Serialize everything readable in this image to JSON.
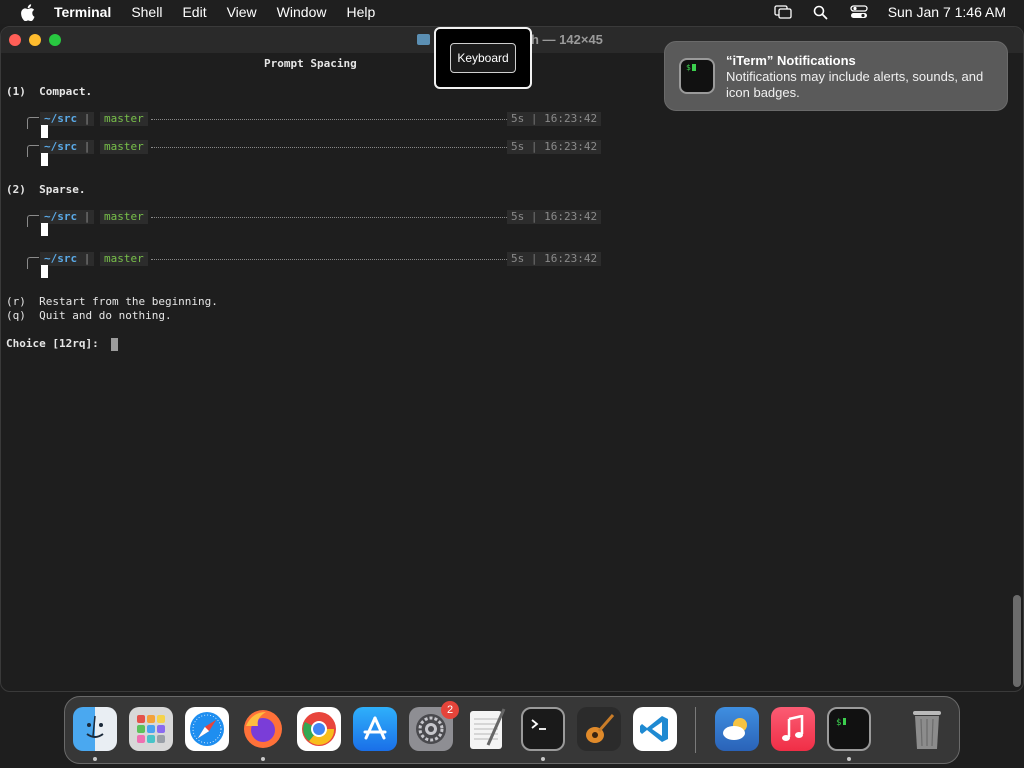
{
  "menubar": {
    "app_name": "Terminal",
    "items": [
      "Shell",
      "Edit",
      "View",
      "Window",
      "Help"
    ],
    "clock": "Sun Jan 7  1:46 AM"
  },
  "window": {
    "title_suffix": "h — 142×45"
  },
  "terminal": {
    "heading": "Prompt Spacing",
    "option1": "(1)  Compact.",
    "option2": "(2)  Sparse.",
    "prompt": {
      "dir": "~/src",
      "sep": "|",
      "branch": "master",
      "duration": "5s",
      "time": "16:23:42"
    },
    "restart": "(r)  Restart from the beginning.",
    "quit": "(q)  Quit and do nothing.",
    "choice": "Choice [12rq]: "
  },
  "keyboard_tooltip": {
    "label": "Keyboard"
  },
  "notification": {
    "title": "“iTerm” Notifications",
    "body": "Notifications may include alerts, sounds, and icon badges.",
    "icon_text": "$"
  },
  "dock": {
    "settings_badge": "2",
    "apps": [
      "finder",
      "launchpad",
      "safari",
      "firefox",
      "chrome",
      "app-store",
      "system-settings",
      "textedit",
      "terminal",
      "garageband",
      "vscode",
      "weather",
      "music",
      "iterm",
      "trash"
    ]
  }
}
